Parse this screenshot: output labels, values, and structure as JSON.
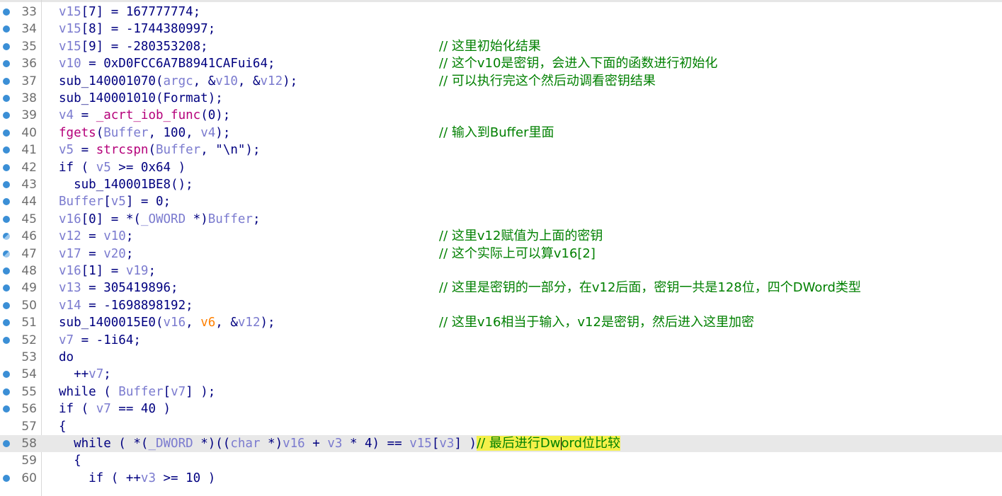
{
  "lines": [
    {
      "n": "33",
      "bp": "full",
      "code": [
        [
          "v",
          "v15"
        ],
        [
          "op",
          "[7] = 167777774;"
        ]
      ]
    },
    {
      "n": "34",
      "bp": "full",
      "code": [
        [
          "v",
          "v15"
        ],
        [
          "op",
          "[8] = -1744380997;"
        ]
      ]
    },
    {
      "n": "35",
      "bp": "full",
      "code": [
        [
          "v",
          "v15"
        ],
        [
          "op",
          "[9] = -280353208;"
        ]
      ],
      "comment": "// 这里初始化结果"
    },
    {
      "n": "36",
      "bp": "full",
      "code": [
        [
          "v",
          "v10"
        ],
        [
          "op",
          " = 0xD0FCC6A7B8941CAFui64;"
        ]
      ],
      "comment": "// 这个v10是密钥，会进入下面的函数进行初始化"
    },
    {
      "n": "37",
      "bp": "full",
      "code": [
        [
          "fn",
          "sub_140001070("
        ],
        [
          "v",
          "argc"
        ],
        [
          "op",
          ", &"
        ],
        [
          "v",
          "v10"
        ],
        [
          "op",
          ", &"
        ],
        [
          "v",
          "v12"
        ],
        [
          "op",
          ");"
        ]
      ],
      "comment": "// 可以执行完这个然后动调看密钥结果"
    },
    {
      "n": "38",
      "bp": "full",
      "code": [
        [
          "fn",
          "sub_140001010(Format);"
        ]
      ]
    },
    {
      "n": "39",
      "bp": "full",
      "code": [
        [
          "v",
          "v4"
        ],
        [
          "op",
          " = "
        ],
        [
          "lib",
          "_acrt_iob_func"
        ],
        [
          "op",
          "(0);"
        ]
      ]
    },
    {
      "n": "40",
      "bp": "full",
      "code": [
        [
          "lib",
          "fgets"
        ],
        [
          "op",
          "("
        ],
        [
          "v",
          "Buffer"
        ],
        [
          "op",
          ", 100, "
        ],
        [
          "v",
          "v4"
        ],
        [
          "op",
          ");"
        ]
      ],
      "comment": "// 输入到Buffer里面"
    },
    {
      "n": "41",
      "bp": "full",
      "code": [
        [
          "v",
          "v5"
        ],
        [
          "op",
          " = "
        ],
        [
          "lib",
          "strcspn"
        ],
        [
          "op",
          "("
        ],
        [
          "v",
          "Buffer"
        ],
        [
          "op",
          ", \"\\n\");"
        ]
      ]
    },
    {
      "n": "42",
      "bp": "full",
      "code": [
        [
          "kw",
          "if ( "
        ],
        [
          "v",
          "v5"
        ],
        [
          "op",
          " >= 0x64 )"
        ]
      ]
    },
    {
      "n": "43",
      "bp": "full",
      "code": [
        [
          "fn",
          "  sub_140001BE8();"
        ]
      ]
    },
    {
      "n": "44",
      "bp": "full",
      "code": [
        [
          "v",
          "Buffer"
        ],
        [
          "op",
          "["
        ],
        [
          "v",
          "v5"
        ],
        [
          "op",
          "] = 0;"
        ]
      ]
    },
    {
      "n": "45",
      "bp": "full",
      "code": [
        [
          "v",
          "v16"
        ],
        [
          "op",
          "[0] = *("
        ],
        [
          "v",
          "_OWORD"
        ],
        [
          "op",
          " *)"
        ],
        [
          "v",
          "Buffer"
        ],
        [
          "op",
          ";"
        ]
      ]
    },
    {
      "n": "46",
      "bp": "half",
      "code": [
        [
          "v",
          "v12"
        ],
        [
          "op",
          " = "
        ],
        [
          "v",
          "v10"
        ],
        [
          "op",
          ";"
        ]
      ],
      "comment": "// 这里v12赋值为上面的密钥"
    },
    {
      "n": "47",
      "bp": "half",
      "code": [
        [
          "v",
          "v17"
        ],
        [
          "op",
          " = "
        ],
        [
          "v",
          "v20"
        ],
        [
          "op",
          ";"
        ]
      ],
      "comment": "// 这个实际上可以算v16[2]"
    },
    {
      "n": "48",
      "bp": "full",
      "code": [
        [
          "v",
          "v16"
        ],
        [
          "op",
          "[1] = "
        ],
        [
          "v",
          "v19"
        ],
        [
          "op",
          ";"
        ]
      ]
    },
    {
      "n": "49",
      "bp": "full",
      "code": [
        [
          "v",
          "v13"
        ],
        [
          "op",
          " = 305419896;"
        ]
      ],
      "comment": "// 这里是密钥的一部分，在v12后面，密钥一共是128位，四个DWord类型"
    },
    {
      "n": "50",
      "bp": "full",
      "code": [
        [
          "v",
          "v14"
        ],
        [
          "op",
          " = -1698898192;"
        ]
      ]
    },
    {
      "n": "51",
      "bp": "full",
      "code": [
        [
          "fn",
          "sub_1400015E0("
        ],
        [
          "v",
          "v16"
        ],
        [
          "op",
          ", "
        ],
        [
          "o",
          "v6"
        ],
        [
          "op",
          ", &"
        ],
        [
          "v",
          "v12"
        ],
        [
          "op",
          ");"
        ]
      ],
      "comment": "// 这里v16相当于输入，v12是密钥，然后进入这里加密"
    },
    {
      "n": "52",
      "bp": "full",
      "code": [
        [
          "v",
          "v7"
        ],
        [
          "op",
          " = -1i64;"
        ]
      ]
    },
    {
      "n": "53",
      "bp": "none",
      "code": [
        [
          "kw",
          "do"
        ]
      ]
    },
    {
      "n": "54",
      "bp": "full",
      "code": [
        [
          "op",
          "  ++"
        ],
        [
          "v",
          "v7"
        ],
        [
          "op",
          ";"
        ]
      ]
    },
    {
      "n": "55",
      "bp": "full",
      "code": [
        [
          "kw",
          "while ( "
        ],
        [
          "v",
          "Buffer"
        ],
        [
          "op",
          "["
        ],
        [
          "v",
          "v7"
        ],
        [
          "op",
          "] );"
        ]
      ]
    },
    {
      "n": "56",
      "bp": "full",
      "code": [
        [
          "kw",
          "if ( "
        ],
        [
          "v",
          "v7"
        ],
        [
          "op",
          " == 40 )"
        ]
      ]
    },
    {
      "n": "57",
      "bp": "none",
      "code": [
        [
          "op",
          "{"
        ]
      ]
    },
    {
      "n": "58",
      "bp": "full",
      "current": true,
      "code": [
        [
          "kw",
          "  while ( *("
        ],
        [
          "v",
          "_DWORD"
        ],
        [
          "op",
          " *)(("
        ],
        [
          "v",
          "char"
        ],
        [
          "op",
          " *)"
        ],
        [
          "v",
          "v16"
        ],
        [
          "op",
          " + "
        ],
        [
          "v",
          "v3"
        ],
        [
          "op",
          " * 4) == "
        ],
        [
          "v",
          "v15"
        ],
        [
          "op",
          "["
        ],
        [
          "v",
          "v3"
        ],
        [
          "op",
          "] )"
        ]
      ],
      "inline_comment_pre": "// 最后进行Dw",
      "inline_comment_post": "ord位比较"
    },
    {
      "n": "59",
      "bp": "none",
      "code": [
        [
          "op",
          "  {"
        ]
      ]
    },
    {
      "n": "60",
      "bp": "full",
      "code": [
        [
          "kw",
          "    if ( ++"
        ],
        [
          "v",
          "v3"
        ],
        [
          "op",
          " >= 10 )"
        ]
      ]
    }
  ]
}
